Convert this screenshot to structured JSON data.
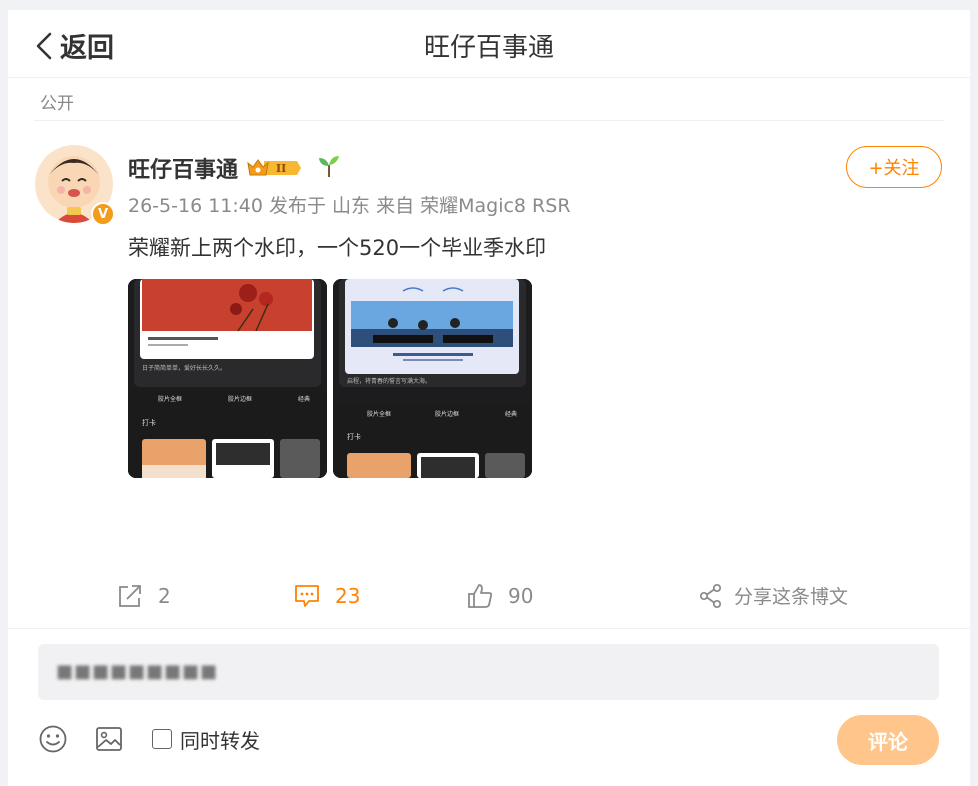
{
  "header": {
    "back_label": "返回",
    "title": "旺仔百事通"
  },
  "post": {
    "visibility": "公开",
    "author": {
      "name": "旺仔百事通",
      "level_badge": "II",
      "verified_mark": "V"
    },
    "meta": "26-5-16 11:40 发布于 山东 来自 荣耀Magic8 RSR",
    "follow_label": "+关注",
    "text": "荣耀新上两个水印，一个520一个毕业季水印",
    "images": [
      {
        "caption": "日子简简单单，爱好长长久久。",
        "tab1": "胶片全框",
        "tab2": "胶片边框",
        "tab3": "经典",
        "section": "打卡"
      },
      {
        "caption": "启程，将青春的誓言写满大海。",
        "tab1": "胶片全框",
        "tab2": "胶片边框",
        "tab3": "经典",
        "section": "打卡"
      }
    ]
  },
  "actions": {
    "share_count": "2",
    "comment_count": "23",
    "like_count": "90",
    "share_post_label": "分享这条博文"
  },
  "composer": {
    "blurred_text": "■■■■■■■■■",
    "repost_label": "同时转发",
    "submit_label": "评论"
  },
  "colors": {
    "accent": "#ff8200",
    "submit_disabled": "#ffc58a"
  }
}
